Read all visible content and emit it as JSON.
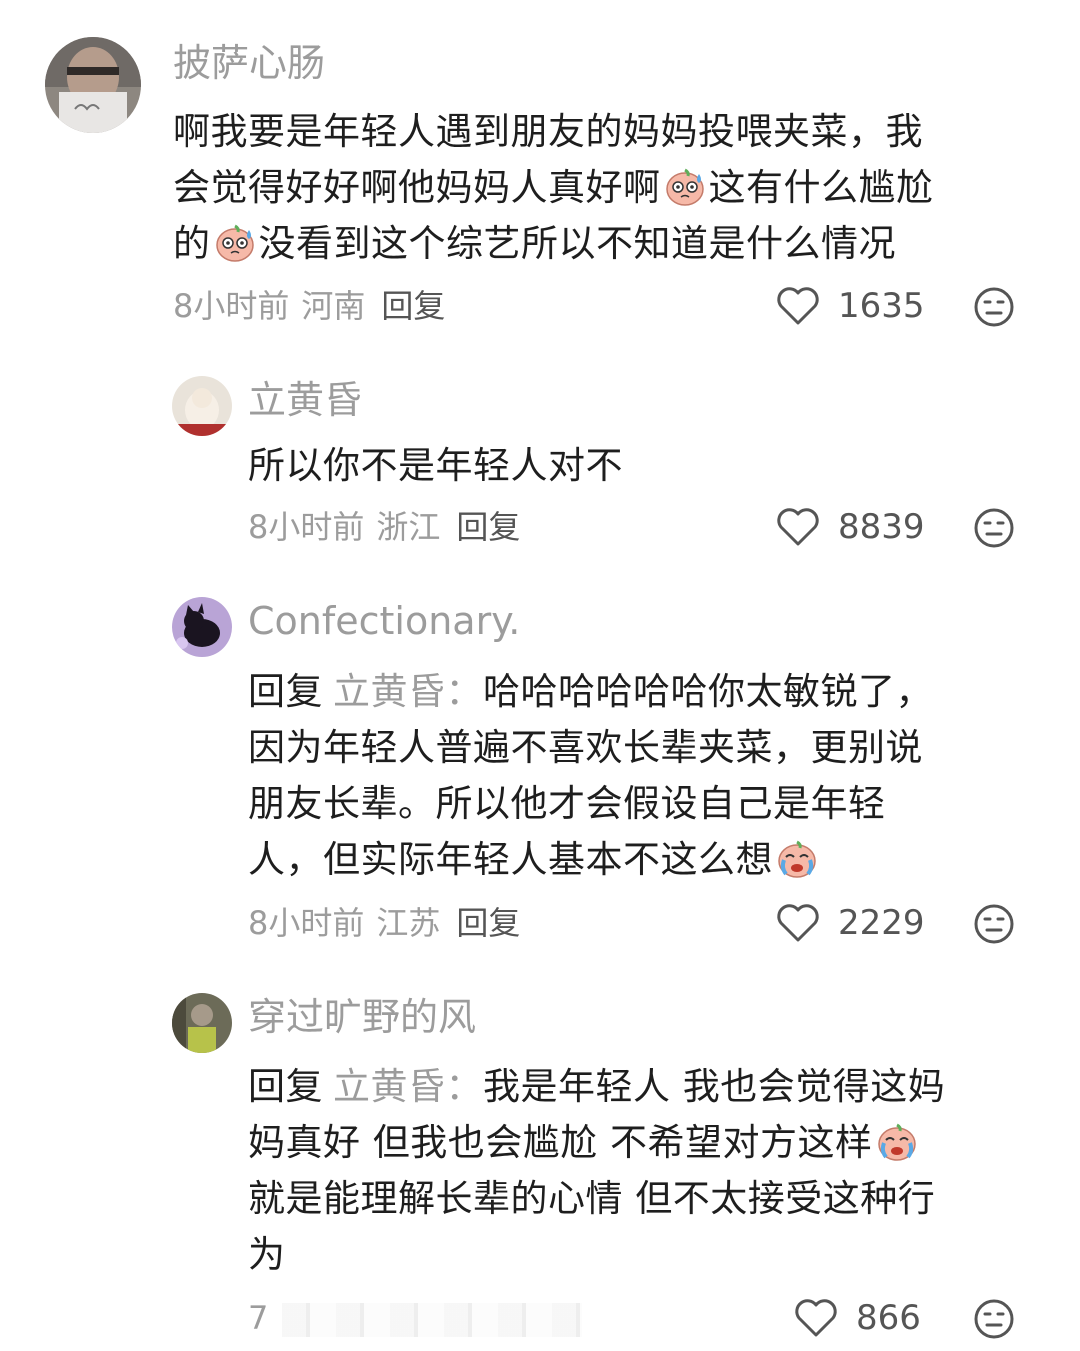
{
  "comments": [
    {
      "username": "披萨心肠",
      "text_line1": "啊我要是年轻人遇到朋友的妈妈投喂夹菜，我",
      "text_line2a": "会觉得好好啊他妈妈人真好啊",
      "text_line2b": "这有什么尴尬",
      "text_line3a": "的",
      "text_line3b": "没看到这个综艺所以不知道是什么情况",
      "time": "8小时前",
      "location": "河南",
      "reply_label": "回复",
      "likes": "1635"
    },
    {
      "username": "立黄昏",
      "text": "所以你不是年轻人对不",
      "time": "8小时前",
      "location": "浙江",
      "reply_label": "回复",
      "likes": "8839"
    },
    {
      "username": "Confectionary.",
      "reply_prefix": "回复",
      "reply_target": "立黄昏：",
      "text_line1": "哈哈哈哈哈哈你太敏锐了，",
      "text_line2": "因为年轻人普遍不喜欢长辈夹菜，更别说",
      "text_line3": "朋友长辈。所以他才会假设自己是年轻",
      "text_line4": "人，但实际年轻人基本不这么想",
      "time": "8小时前",
      "location": "江苏",
      "reply_label": "回复",
      "likes": "2229"
    },
    {
      "username": "穿过旷野的风",
      "reply_prefix": "回复",
      "reply_target": "立黄昏：",
      "text_line1": "我是年轻人 我也会觉得这妈",
      "text_line2": "妈真好 但我也会尴尬 不希望对方这样",
      "text_line3": "就是能理解长辈的心情 但不太接受这种行",
      "text_line4": "为",
      "time": "7",
      "likes": "866"
    }
  ],
  "icons": {
    "like": "heart-outline-icon",
    "dislike": "neutral-face-icon",
    "emoji_sweat": "sweat-peach-emoji",
    "emoji_cry": "crying-peach-emoji"
  },
  "colors": {
    "username": "#9c9c9c",
    "text": "#1e1e1e",
    "meta": "#9c9c9c",
    "icon": "#555555"
  }
}
